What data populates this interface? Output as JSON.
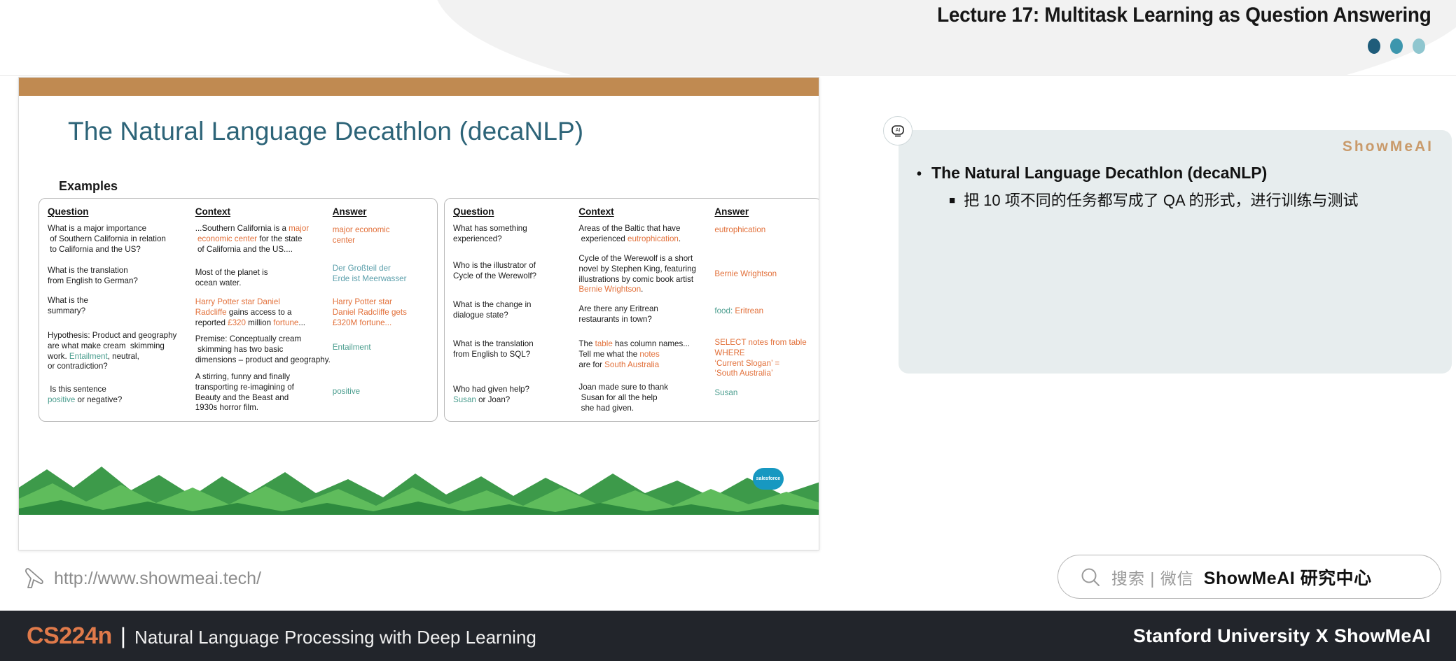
{
  "header": {
    "title": "Lecture 17: Multitask Learning as Question Answering",
    "dots": [
      "dot-dark-teal",
      "dot-teal",
      "dot-light-teal"
    ]
  },
  "slide": {
    "title": "The Natural Language Decathlon (decaNLP)",
    "examples_label": "Examples",
    "logo_label": "salesforce",
    "left_table": {
      "headers": {
        "question": "Question",
        "context": "Context",
        "answer": "Answer"
      },
      "questions": [
        "What is a major importance of Southern California in relation to California and the US?",
        "What is the translation from English to German?",
        "What is the summary?",
        "Hypothesis: Product and geography are what make cream  skimming work. Entailment, neutral, or contradiction?",
        "Is this sentence positive or negative?"
      ],
      "contexts": [
        "...Southern California is a major economic center for the state of California and the US....",
        "Most of the planet is ocean water.",
        "Harry Potter star Daniel Radcliffe gains access to a reported £320 million fortune...",
        "Premise: Conceptually cream skimming has two basic dimensions – product and geography.",
        "A stirring, funny and finally transporting re-imagining of Beauty and the Beast and 1930s horror film."
      ],
      "answers": [
        "major economic center",
        "Der Großteil der Erde ist Meerwasser",
        "Harry Potter star Daniel Radcliffe gets £320M fortune...",
        "Entailment",
        "positive"
      ]
    },
    "right_table": {
      "headers": {
        "question": "Question",
        "context": "Context",
        "answer": "Answer"
      },
      "questions": [
        "What has something experienced?",
        "Who is the illustrator of Cycle of the Werewolf?",
        "What is the change in dialogue state?",
        "What is the translation from English to SQL?",
        "Who had given help? Susan or Joan?"
      ],
      "contexts": [
        "Areas of the Baltic that have experienced eutrophication.",
        "Cycle of the Werewolf is a short novel by Stephen King, featuring illustrations by comic book artist Bernie Wrightson.",
        "Are there any Eritrean restaurants in town?",
        "The table has column names... Tell me what the notes are for South Australia",
        "Joan made sure to thank Susan for all the help she had given."
      ],
      "answers": [
        "eutrophication",
        "Bernie Wrightson",
        "food: Eritrean",
        "SELECT notes from table WHERE ‘Current Slogan’ = ‘South Australia’",
        "Susan"
      ]
    }
  },
  "site": {
    "url": "http://www.showmeai.tech/"
  },
  "notes": {
    "brand": "ShowMeAI",
    "bullet_marker": "•",
    "bullet1": "The Natural Language Decathlon (decaNLP)",
    "sub_marker": "■",
    "bullet2": "把 10 项不同的任务都写成了 QA 的形式，进行训练与测试"
  },
  "search": {
    "placeholder": "搜索 | 微信",
    "brand": "ShowMeAI 研究中心"
  },
  "footer": {
    "course_code": "CS224n",
    "separator": "|",
    "course_name": "Natural Language Processing with Deep Learning",
    "university": "Stanford University",
    "x": "X",
    "partner": "ShowMeAI"
  },
  "colors": {
    "accent_orange": "#e2703a",
    "accent_green": "#4a9d8e",
    "slide_bar": "#c08a51",
    "title_blue": "#2d6478",
    "footer_bg": "#22252b",
    "brand_gold": "#c99a6a"
  }
}
